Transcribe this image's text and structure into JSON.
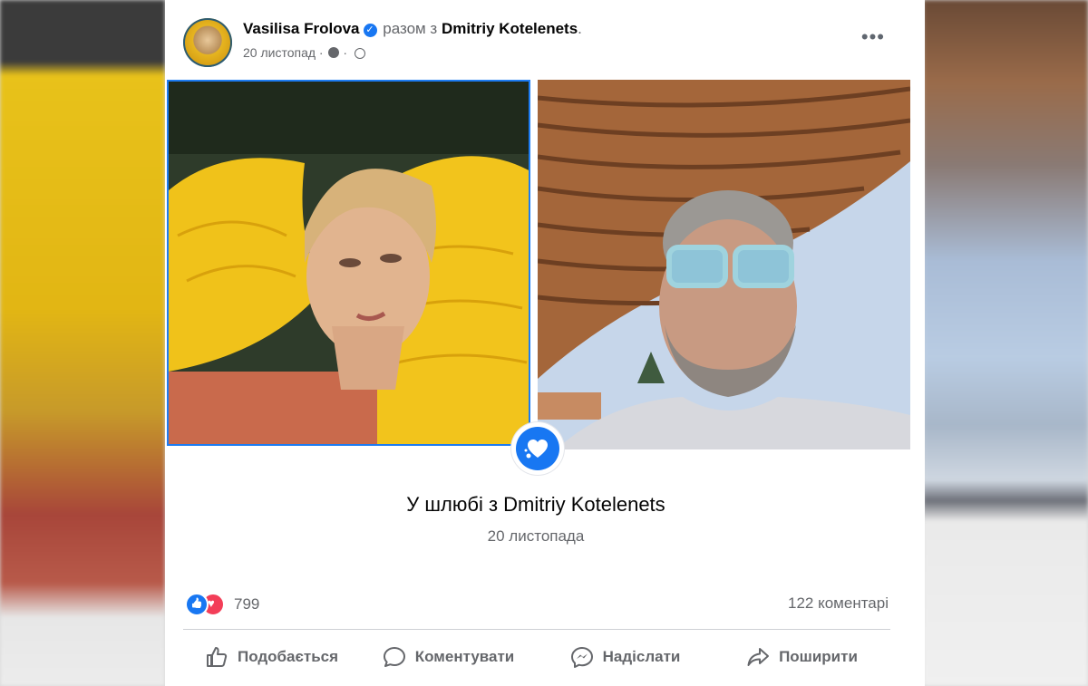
{
  "post": {
    "author": "Vasilisa Frolova",
    "with_text": "разом з",
    "tagged": "Dmitriy Kotelenets",
    "tagged_suffix": ".",
    "date": "20 листопад",
    "date_sep": "·",
    "more_label": "•••"
  },
  "event": {
    "title": "У шлюбі з Dmitriy Kotelenets",
    "date": "20 листопада"
  },
  "stats": {
    "reactions_count": "799",
    "comments": "122 коментарі"
  },
  "actions": [
    {
      "label": "Подобається",
      "icon": "like-icon"
    },
    {
      "label": "Коментувати",
      "icon": "comment-icon"
    },
    {
      "label": "Надіслати",
      "icon": "messenger-icon"
    },
    {
      "label": "Поширити",
      "icon": "share-icon"
    }
  ],
  "colors": {
    "accent": "#1877f2",
    "love": "#f33e58",
    "text_secondary": "#65676b"
  }
}
